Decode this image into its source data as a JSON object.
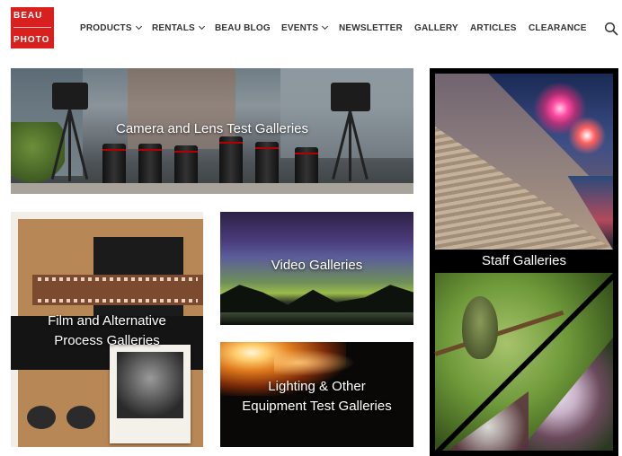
{
  "header": {
    "logo": {
      "line1": "BEAU",
      "line2": "PHOTO"
    },
    "nav": [
      {
        "label": "PRODUCTS",
        "dropdown": true
      },
      {
        "label": "RENTALS",
        "dropdown": true
      },
      {
        "label": "BEAU BLOG",
        "dropdown": false
      },
      {
        "label": "EVENTS",
        "dropdown": true
      },
      {
        "label": "NEWSLETTER",
        "dropdown": false
      },
      {
        "label": "GALLERY",
        "dropdown": false
      },
      {
        "label": "ARTICLES",
        "dropdown": false
      },
      {
        "label": "CLEARANCE",
        "dropdown": false
      }
    ],
    "search_icon": "search-icon"
  },
  "tiles": {
    "camera": {
      "label": "Camera and Lens Test Galleries"
    },
    "film": {
      "label_line1": "Film and Alternative",
      "label_line2": "Process Galleries"
    },
    "video": {
      "label": "Video Galleries"
    },
    "lighting": {
      "label_line1": "Lighting & Other",
      "label_line2": "Equipment Test Galleries"
    },
    "staff": {
      "label": "Staff Galleries"
    }
  },
  "colors": {
    "brand_red": "#d8201f",
    "nav_text": "#333333"
  }
}
